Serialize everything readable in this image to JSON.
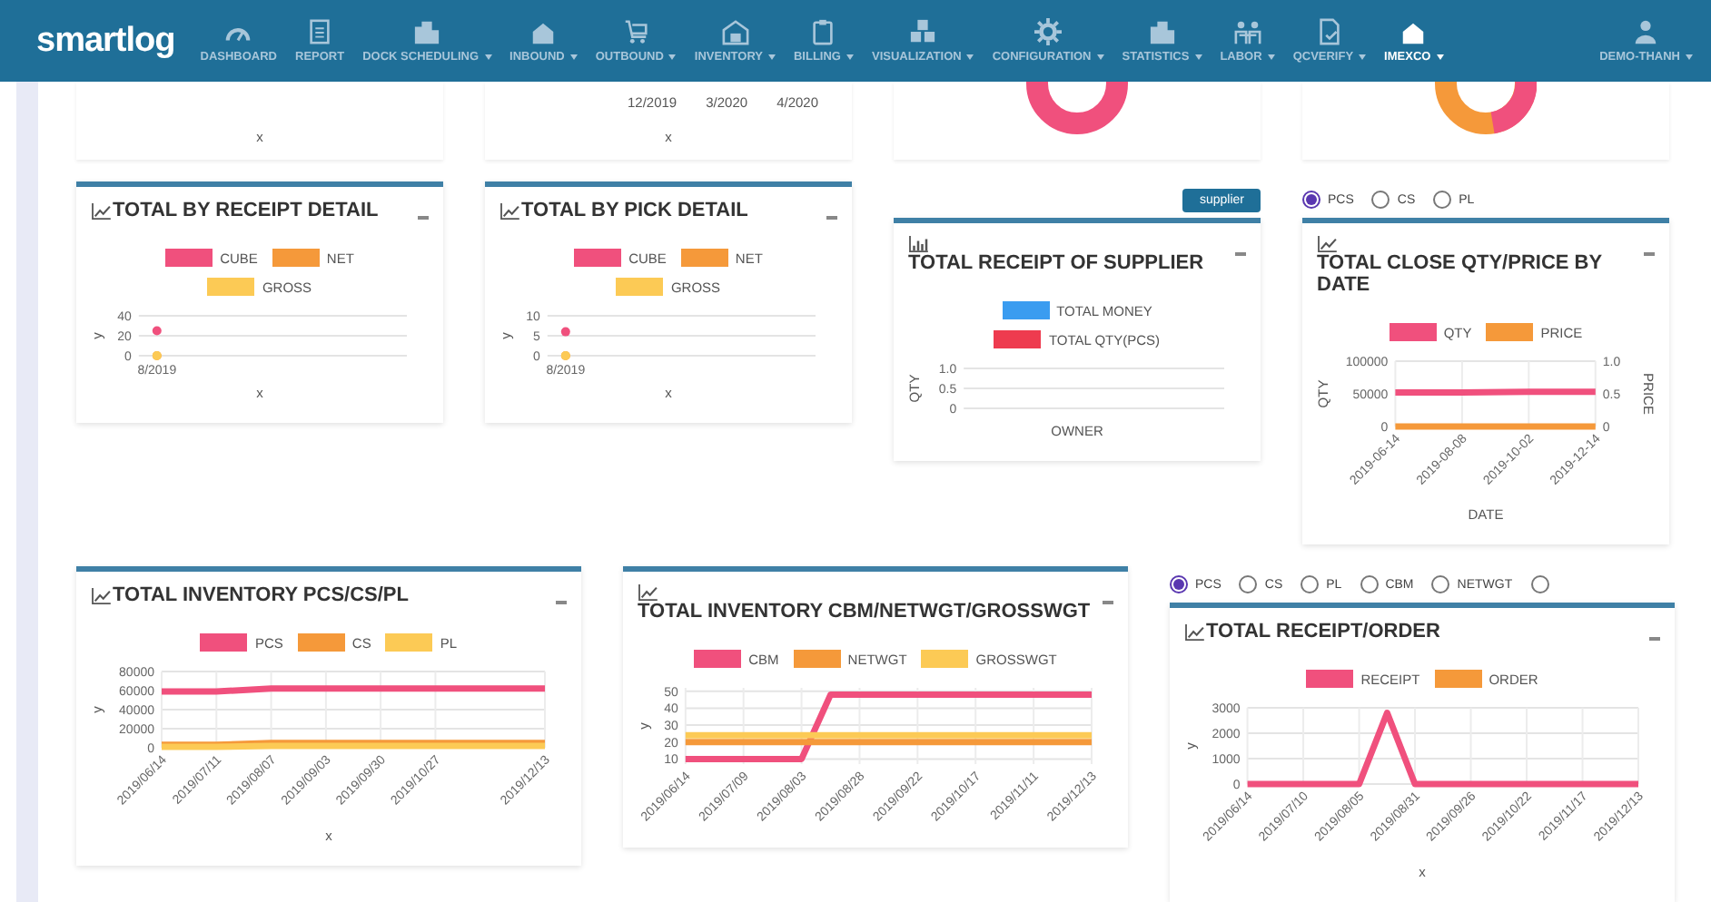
{
  "nav": {
    "logo": "smartlog",
    "items": [
      {
        "label": "DASHBOARD",
        "dropdown": false,
        "selected": false
      },
      {
        "label": "REPORT",
        "dropdown": false,
        "selected": false
      },
      {
        "label": "DOCK SCHEDULING",
        "dropdown": true,
        "selected": false
      },
      {
        "label": "INBOUND",
        "dropdown": true,
        "selected": false
      },
      {
        "label": "OUTBOUND",
        "dropdown": true,
        "selected": false
      },
      {
        "label": "INVENTORY",
        "dropdown": true,
        "selected": false
      },
      {
        "label": "BILLING",
        "dropdown": true,
        "selected": false
      },
      {
        "label": "VISUALIZATION",
        "dropdown": true,
        "selected": false
      },
      {
        "label": "CONFIGURATION",
        "dropdown": true,
        "selected": false
      },
      {
        "label": "STATISTICS",
        "dropdown": true,
        "selected": false
      },
      {
        "label": "LABOR",
        "dropdown": true,
        "selected": false
      },
      {
        "label": "QCVERIFY",
        "dropdown": true,
        "selected": false
      },
      {
        "label": "IMEXCO",
        "dropdown": true,
        "selected": true
      }
    ],
    "user": {
      "label": "DEMO-THANH",
      "dropdown": true
    }
  },
  "partial_cards": [
    {
      "kind": "axis",
      "xlabel": "x"
    },
    {
      "kind": "axis",
      "x_ticks": [
        "12/2019",
        "3/2020",
        "4/2020"
      ],
      "xlabel": "x"
    },
    {
      "kind": "donut"
    },
    {
      "kind": "donut"
    }
  ],
  "rows": [
    {
      "cards": [
        {
          "title": "TOTAL BY RECEIPT DETAIL",
          "chart_data": {
            "type": "line",
            "grid": true,
            "legend": "top",
            "xlabel": "x",
            "ylabel": "y",
            "categories": [
              "8/2019"
            ],
            "ylim": [
              0,
              40
            ],
            "yticks": [
              0,
              20,
              40
            ],
            "series": [
              {
                "name": "CUBE",
                "color": "#f0507d",
                "marker": true,
                "values": [
                  25
                ]
              },
              {
                "name": "NET",
                "color": "#f5993a",
                "marker": true,
                "values": [
                  0
                ]
              },
              {
                "name": "GROSS",
                "color": "#fcca55",
                "marker": true,
                "values": [
                  0
                ]
              }
            ]
          }
        },
        {
          "title": "TOTAL BY PICK DETAIL",
          "chart_data": {
            "type": "line",
            "grid": true,
            "legend": "top",
            "xlabel": "x",
            "ylabel": "y",
            "categories": [
              "8/2019"
            ],
            "ylim": [
              0,
              10
            ],
            "yticks": [
              0,
              5,
              10
            ],
            "series": [
              {
                "name": "CUBE",
                "color": "#f0507d",
                "marker": true,
                "values": [
                  6
                ]
              },
              {
                "name": "NET",
                "color": "#f5993a",
                "marker": true,
                "values": [
                  0
                ]
              },
              {
                "name": "GROSS",
                "color": "#fcca55",
                "marker": true,
                "values": [
                  0
                ]
              }
            ]
          }
        },
        {
          "title": "TOTAL RECEIPT OF SUPPLIER",
          "controls": {
            "kind": "button",
            "label": "supplier"
          },
          "chart_data": {
            "type": "bar",
            "grid": true,
            "legend": "top",
            "xlabel": "OWNER",
            "ylabel": "QTY",
            "ylim": [
              0,
              1
            ],
            "yticks": [
              0,
              0.5,
              {
                "value": 1,
                "label": "1.0"
              }
            ],
            "series": [
              {
                "name": "TOTAL MONEY",
                "color": "#3a9cf0"
              },
              {
                "name": "TOTAL QTY(PCS)",
                "color": "#ee3b4f"
              }
            ]
          }
        },
        {
          "title": "TOTAL CLOSE QTY/PRICE BY DATE",
          "controls": {
            "kind": "radios",
            "options": [
              {
                "label": "PCS",
                "selected": true
              },
              {
                "label": "CS",
                "selected": false
              },
              {
                "label": "PL",
                "selected": false
              }
            ]
          },
          "chart_data": {
            "type": "line",
            "grid": true,
            "legend": "top",
            "xlabel": "DATE",
            "ylabel": "QTY",
            "y2label": "PRICE",
            "categories": [
              "2019-06-14",
              "2019-08-08",
              "2019-10-02",
              "2019-12-14"
            ],
            "ylim": [
              0,
              100000
            ],
            "yticks": [
              0,
              50000,
              100000
            ],
            "y2lim": [
              0,
              1
            ],
            "y2ticks": [
              0,
              0.5,
              {
                "value": 1,
                "label": "1.0"
              }
            ],
            "series": [
              {
                "name": "QTY",
                "color": "#f0507d",
                "values": [
                  52000,
                  52000,
                  53000,
                  53000
                ]
              },
              {
                "name": "PRICE",
                "color": "#f5993a",
                "values": [
                  0,
                  0,
                  0,
                  0
                ]
              }
            ]
          }
        }
      ]
    },
    {
      "cards": [
        {
          "title": "TOTAL INVENTORY PCS/CS/PL",
          "chart_data": {
            "type": "line",
            "grid": true,
            "legend": "top",
            "xlabel": "x",
            "ylabel": "y",
            "categories": [
              "2019/06/14",
              "2019/07/11",
              "2019/08/07",
              "2019/09/03",
              "2019/09/30",
              "2019/10/27",
              null,
              "2019/12/13"
            ],
            "ylim": [
              0,
              80000
            ],
            "yticks": [
              0,
              20000,
              40000,
              60000,
              80000
            ],
            "series": [
              {
                "name": "PCS",
                "color": "#f0507d",
                "values": [
                  59000,
                  59000,
                  62000,
                  62000,
                  62000,
                  62000,
                  62000,
                  62000
                ]
              },
              {
                "name": "CS",
                "color": "#f5993a",
                "values": [
                  3000,
                  3000,
                  5000,
                  5000,
                  5000,
                  5000,
                  5000,
                  5000
                ]
              },
              {
                "name": "PL",
                "color": "#fcca55",
                "values": [
                  1000,
                  1000,
                  2000,
                  2000,
                  2000,
                  2000,
                  2000,
                  2000
                ]
              }
            ]
          }
        },
        {
          "title": "TOTAL INVENTORY CBM/NETWGT/GROSSWGT",
          "chart_data": {
            "type": "line",
            "grid": true,
            "legend": "top",
            "ylabel": "y",
            "categories": [
              "2019/06/14",
              null,
              "2019/07/09",
              null,
              "2019/08/03",
              null,
              "2019/08/28",
              null,
              "2019/09/22",
              null,
              "2019/10/17",
              null,
              "2019/11/11",
              null,
              "2019/12/13"
            ],
            "ylim": [
              7,
              52
            ],
            "yticks": [
              10,
              20,
              30,
              40,
              50
            ],
            "series": [
              {
                "name": "CBM",
                "color": "#f0507d",
                "values": [
                  10,
                  10,
                  10,
                  10,
                  10,
                  48,
                  48,
                  48,
                  48,
                  48,
                  48,
                  48,
                  48,
                  48,
                  48
                ]
              },
              {
                "name": "NETWGT",
                "color": "#f5993a",
                "values": [
                  20,
                  20,
                  20,
                  20,
                  20,
                  20,
                  20,
                  20,
                  20,
                  20,
                  20,
                  20,
                  20,
                  20,
                  20
                ]
              },
              {
                "name": "GROSSWGT",
                "color": "#fcca55",
                "values": [
                  24,
                  24,
                  24,
                  24,
                  24,
                  24,
                  24,
                  24,
                  24,
                  24,
                  24,
                  24,
                  24,
                  24,
                  24
                ]
              }
            ]
          }
        },
        {
          "title": "TOTAL RECEIPT/ORDER",
          "controls": {
            "kind": "radios",
            "options": [
              {
                "label": "PCS",
                "selected": true
              },
              {
                "label": "CS",
                "selected": false
              },
              {
                "label": "PL",
                "selected": false
              },
              {
                "label": "CBM",
                "selected": false
              },
              {
                "label": "NETWGT",
                "selected": false
              },
              {
                "selected": false
              }
            ]
          },
          "chart_data": {
            "type": "line",
            "grid": true,
            "legend": "top",
            "xlabel": "x",
            "ylabel": "y",
            "categories": [
              "2019/06/14",
              null,
              "2019/07/10",
              null,
              "2019/08/05",
              null,
              "2019/08/31",
              null,
              "2019/09/26",
              null,
              "2019/10/22",
              null,
              "2019/11/17",
              null,
              "2019/12/13"
            ],
            "ylim": [
              0,
              3000
            ],
            "yticks": [
              0,
              1000,
              2000,
              3000
            ],
            "series": [
              {
                "name": "RECEIPT",
                "color": "#f0507d",
                "values": [
                  0,
                  0,
                  0,
                  0,
                  0,
                  2800,
                  0,
                  0,
                  0,
                  0,
                  0,
                  0,
                  0,
                  0,
                  0
                ]
              },
              {
                "name": "ORDER",
                "color": "#f5993a",
                "values": [
                  null,
                  null,
                  null,
                  null,
                  null,
                  null,
                  null,
                  null,
                  null,
                  null,
                  null,
                  null,
                  null,
                  null,
                  null
                ]
              }
            ]
          }
        }
      ]
    }
  ]
}
